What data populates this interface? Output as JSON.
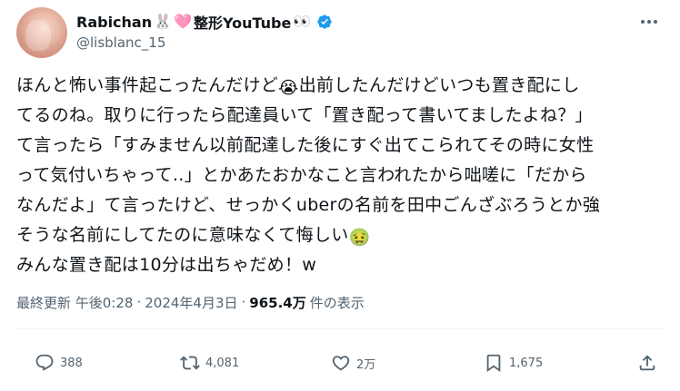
{
  "author": {
    "display_name": "Rabichan",
    "name_emojis": [
      "🐰",
      "🩷"
    ],
    "name_suffix": "整形YouTube",
    "suffix_emoji": "👀",
    "handle": "@lisblanc_15",
    "verified_icon": "verified-badge-icon",
    "accent_color": "#1d9bf0"
  },
  "tweet": {
    "lines": [
      {
        "before": "ほんと怖い事件起こったんだけど",
        "emoji": "😭",
        "after": "出前したんだけどいつも置き配にし"
      },
      {
        "text": "てるのね。取りに行ったら配達員いて「置き配って書いてましたよね？」"
      },
      {
        "text": "て言ったら「すみません以前配達した後にすぐ出てこられてその時に女性"
      },
      {
        "text": "って気付いちゃって‥」とかあたおかなこと言われたから咄嗟に「だから"
      },
      {
        "text": "なんだよ」て言ったけど、せっかくuberの名前を田中ごんざぶろうとか強"
      },
      {
        "before": "そうな名前にしてたのに意味なくて悔しい",
        "emoji": "🤢",
        "after": ""
      },
      {
        "text": "みんな置き配は10分は出ちゃだめ！w"
      }
    ]
  },
  "meta": {
    "updated_label": "最終更新 午後0:28",
    "date": "2024年4月3日",
    "views_count": "965.4万",
    "views_label": "件の表示"
  },
  "actions": {
    "reply_count": "388",
    "retweet_count": "4,081",
    "like_count": "2万",
    "bookmark_count": "1,675"
  }
}
